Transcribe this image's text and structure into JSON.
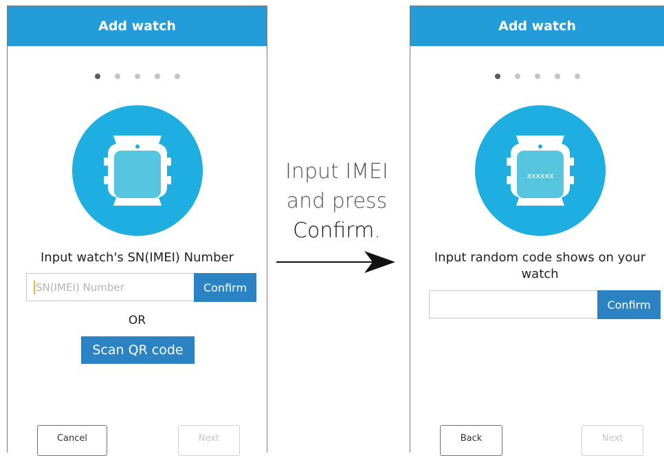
{
  "left_screen": {
    "title": "Add watch",
    "pagination": {
      "count": 5,
      "active": 1
    },
    "prompt": "Input watch's SN(IMEI) Number",
    "input": {
      "value": "",
      "placeholder": "SN(IMEI) Number"
    },
    "confirm_label": "Confirm",
    "or_label": "OR",
    "scan_label": "Scan QR code",
    "cancel_label": "Cancel",
    "next_label": "Next"
  },
  "instruction": {
    "line1": "Input IMEI",
    "line2": "and press",
    "line3_bold": "Confirm",
    "line3_tail": "."
  },
  "right_screen": {
    "title": "Add watch",
    "pagination": {
      "count": 5,
      "active": 1
    },
    "watch_screen_text": "xxxxxx",
    "prompt": "Input random code shows on your watch",
    "input": {
      "value": "",
      "placeholder": ""
    },
    "confirm_label": "Confirm",
    "back_label": "Back",
    "next_label": "Next"
  },
  "colors": {
    "header": "#249cd9",
    "circle": "#1eaee0",
    "watch_screen": "#55c6dd",
    "button": "#2c83c4"
  },
  "icons": [
    "watch-icon",
    "arrow-right-icon"
  ]
}
